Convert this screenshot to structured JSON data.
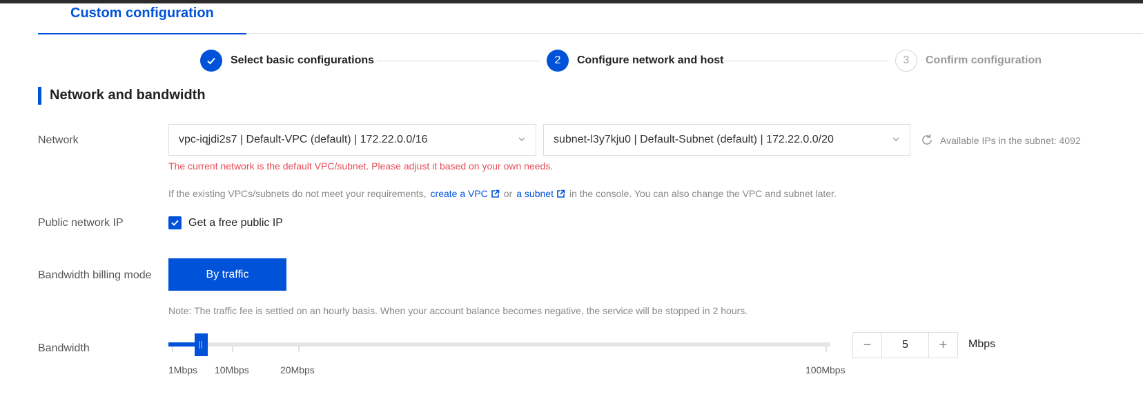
{
  "tab": {
    "label": "Custom configuration"
  },
  "steps": [
    {
      "label": "Select basic configurations",
      "state": "done",
      "icon": "check-icon"
    },
    {
      "number": "2",
      "label": "Configure network and host",
      "state": "active"
    },
    {
      "number": "3",
      "label": "Confirm configuration",
      "state": "pending"
    }
  ],
  "section": {
    "title": "Network and bandwidth"
  },
  "network": {
    "label": "Network",
    "vpc_value": "vpc-iqjdi2s7 | Default-VPC (default) | 172.22.0.0/16",
    "subnet_value": "subnet-l3y7kju0 | Default-Subnet (default) | 172.22.0.0/20",
    "available_ips_text": "Available IPs in the subnet: 4092",
    "warning": "The current network is the default VPC/subnet. Please adjust it based on your own needs.",
    "hint_prefix": "If the existing VPCs/subnets do not meet your requirements,",
    "create_vpc_link": "create a VPC",
    "hint_or": "or",
    "subnet_link": "a subnet",
    "hint_suffix": "in the console. You can also change the VPC and subnet later."
  },
  "public_ip": {
    "label": "Public network IP",
    "checkbox_label": "Get a free public IP",
    "checked": true
  },
  "billing": {
    "label": "Bandwidth billing mode",
    "button_label": "By traffic",
    "note": "Note: The traffic fee is settled on an hourly basis. When your account balance becomes negative, the service will be stopped in 2 hours."
  },
  "bandwidth": {
    "label": "Bandwidth",
    "value": "5",
    "unit": "Mbps",
    "decrement": "−",
    "increment": "+",
    "slider_min": 1,
    "slider_max": 100,
    "ticks": [
      "1Mbps",
      "10Mbps",
      "20Mbps",
      "100Mbps"
    ]
  },
  "colors": {
    "accent": "#0052d9",
    "warning": "#e34d59"
  }
}
